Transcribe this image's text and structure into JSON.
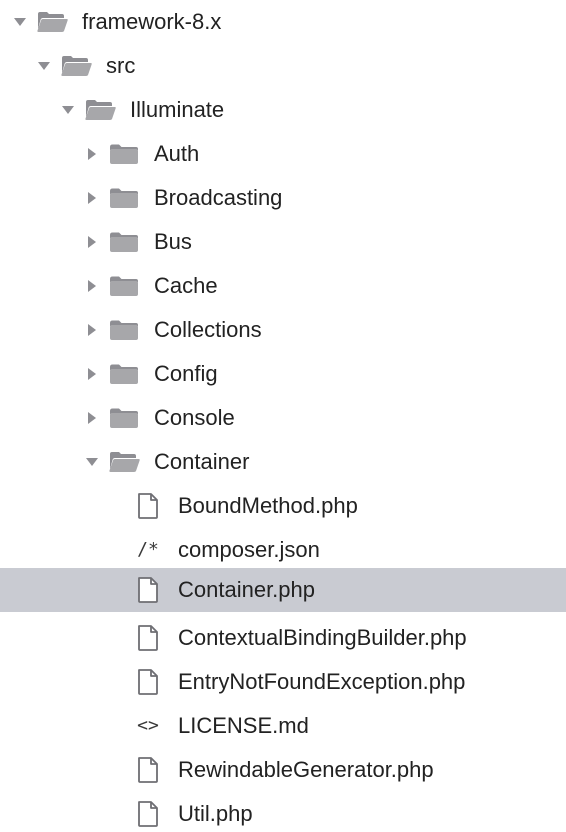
{
  "tree": {
    "root": {
      "label": "framework-8.x"
    },
    "src": {
      "label": "src"
    },
    "illuminate": {
      "label": "Illuminate"
    },
    "folders": [
      {
        "label": "Auth"
      },
      {
        "label": "Broadcasting"
      },
      {
        "label": "Bus"
      },
      {
        "label": "Cache"
      },
      {
        "label": "Collections"
      },
      {
        "label": "Config"
      },
      {
        "label": "Console"
      }
    ],
    "container": {
      "label": "Container"
    },
    "files": [
      {
        "label": "BoundMethod.php",
        "icon": "document-icon"
      },
      {
        "label": "composer.json",
        "icon": "json-comment-icon",
        "glyph": "/*"
      },
      {
        "label": "Container.php",
        "icon": "document-icon",
        "selected": true
      },
      {
        "label": "ContextualBindingBuilder.php",
        "icon": "document-icon"
      },
      {
        "label": "EntryNotFoundException.php",
        "icon": "document-icon"
      },
      {
        "label": "LICENSE.md",
        "icon": "markup-code-icon",
        "glyph": "<>"
      },
      {
        "label": "RewindableGenerator.php",
        "icon": "document-icon"
      },
      {
        "label": "Util.php",
        "icon": "document-icon"
      }
    ]
  },
  "colors": {
    "selection": "#c9cbd2",
    "folder": "#a7a7aa",
    "chevron": "#8e8e93",
    "text": "#222222"
  }
}
